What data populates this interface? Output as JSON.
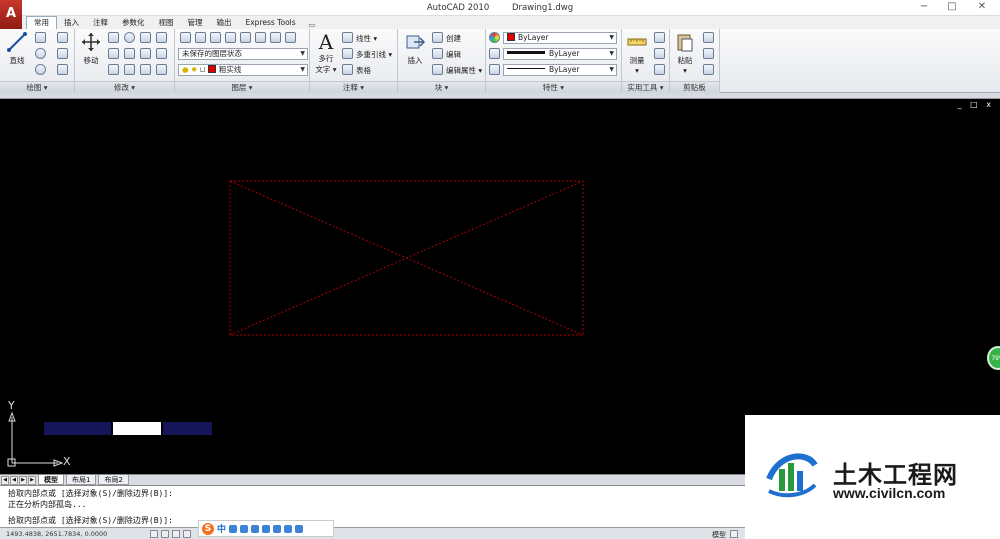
{
  "window": {
    "app_name": "AutoCAD 2010",
    "file_name": "Drawing1.dwg",
    "app_button_icon": "autocad-logo-icon",
    "controls": [
      "−",
      "□",
      "✕"
    ]
  },
  "ribbon_tabs": [
    {
      "label": "常用",
      "active": true
    },
    {
      "label": "插入"
    },
    {
      "label": "注释"
    },
    {
      "label": "参数化"
    },
    {
      "label": "视图"
    },
    {
      "label": "管理"
    },
    {
      "label": "输出"
    },
    {
      "label": "Express Tools"
    }
  ],
  "ribbon_tab_options": "▭",
  "panels": {
    "draw": {
      "label": "绘图",
      "line": "直线"
    },
    "modify": {
      "label": "修改",
      "move": "移动"
    },
    "layer": {
      "label": "图层",
      "layer_state": "未保存的图层状态",
      "current_layer": "粗实线",
      "layer_color": "#e00000"
    },
    "annotation": {
      "label": "注释",
      "mtext": "多行",
      "mtext2": "文字",
      "linear": "线性",
      "mleader": "多重引线",
      "table": "表格"
    },
    "block": {
      "label": "块",
      "insert": "插入",
      "create": "创建",
      "edit": "编辑",
      "edit_attr": "编辑属性"
    },
    "properties": {
      "label": "特性",
      "color": "ByLayer",
      "lineweight": "ByLayer",
      "linetype": "ByLayer",
      "color_swatch": "#e00000"
    },
    "utilities": {
      "label": "实用工具",
      "measure": "测量"
    },
    "clipboard": {
      "label": "剪贴板",
      "paste": "粘贴"
    }
  },
  "canvas": {
    "background": "#000000",
    "entity_color": "#b00000",
    "ucs_x": "X",
    "ucs_y": "Y",
    "controls": "_ □ x",
    "bar_colors": [
      "#15155a",
      "#ffffff",
      "#15155a"
    ]
  },
  "layout_tabs": [
    "模型",
    "布局1",
    "布局2"
  ],
  "command_lines": [
    "拾取内部点或 [选择对象(S)/删除边界(B)]:",
    "正在分析内部孤岛...",
    "拾取内部点或 [选择对象(S)/删除边界(B)]:"
  ],
  "status": {
    "coords": "1493.4838, 2651.7834, 0.0000",
    "model": "模型"
  },
  "ime": {
    "brand": "S",
    "lang": "中"
  },
  "watermark": {
    "cn": "土木工程网",
    "url": "www.civilcn.com"
  },
  "float_badge": "79%"
}
